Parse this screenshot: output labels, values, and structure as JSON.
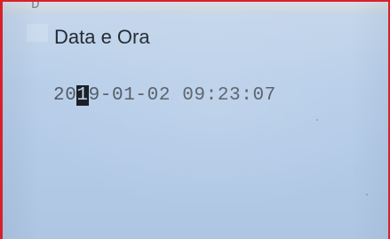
{
  "screen": {
    "top_strip_text": "D         ",
    "title": "Data e Ora",
    "datetime": {
      "before_cursor": "20",
      "cursor_char": "1",
      "after_cursor": "9-01-02 09:23:07"
    }
  },
  "colors": {
    "border": "#d8202a",
    "lcd_background": "#b9cfe9",
    "title_text": "#222a33",
    "lcd_text": "#505862",
    "cursor_background": "#141a22"
  }
}
